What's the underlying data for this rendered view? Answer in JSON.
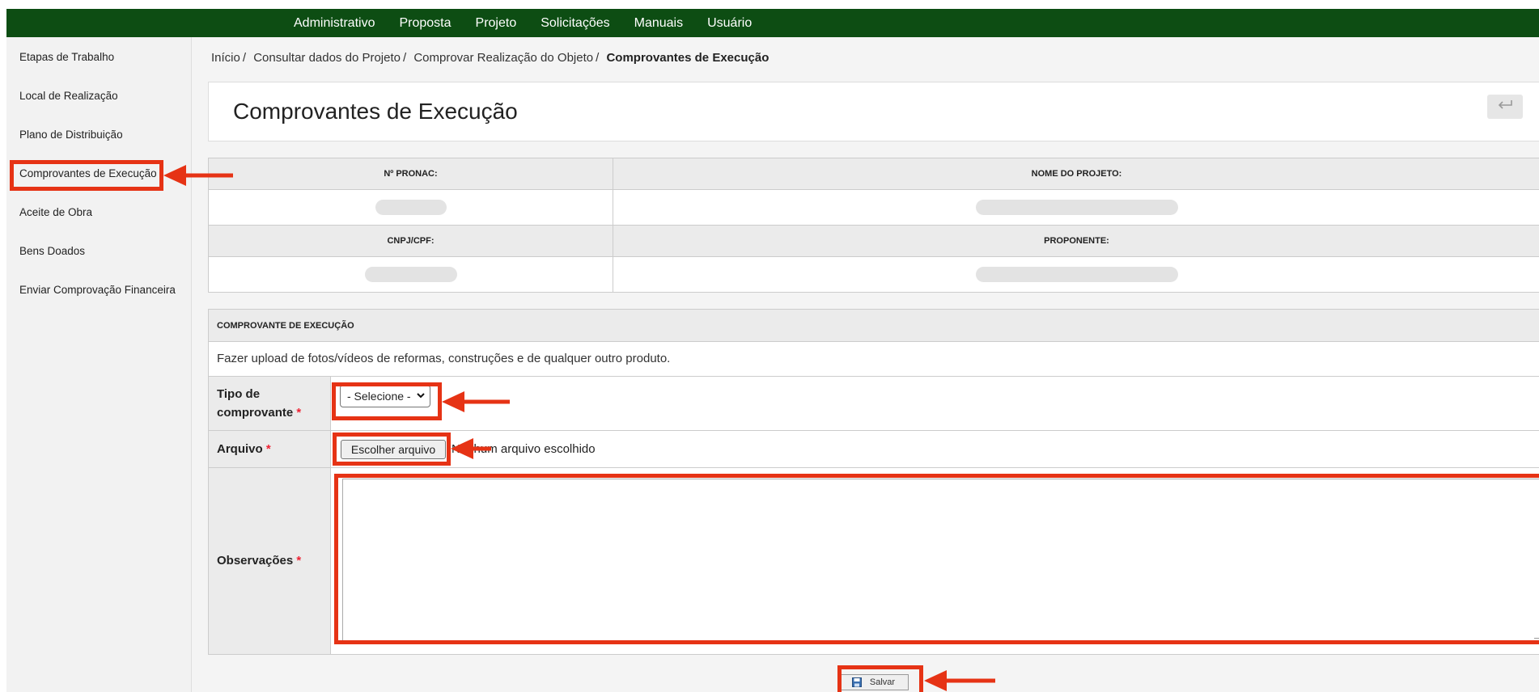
{
  "nav": {
    "items": [
      "Administrativo",
      "Proposta",
      "Projeto",
      "Solicitações",
      "Manuais",
      "Usuário"
    ]
  },
  "sidebar": {
    "items": [
      "Etapas de Trabalho",
      "Local de Realização",
      "Plano de Distribuição",
      "Comprovantes de Execução",
      "Aceite de Obra",
      "Bens Doados",
      "Enviar Comprovação Financeira"
    ],
    "active_index": 3
  },
  "breadcrumb": {
    "items": [
      "Início",
      "Consultar dados do Projeto",
      "Comprovar Realização do Objeto"
    ],
    "current": "Comprovantes de Execução"
  },
  "page": {
    "title": "Comprovantes de Execução"
  },
  "project_info": {
    "pronac_label": "Nº PRONAC:",
    "nome_label": "NOME DO PROJETO:",
    "cnpj_label": "CNPJ/CPF:",
    "proponente_label": "PROPONENTE:"
  },
  "form": {
    "header": "COMPROVANTE DE EXECUÇÃO",
    "description": "Fazer upload de fotos/vídeos de reformas, construções e de qualquer outro produto.",
    "tipo_label_line1": "Tipo de",
    "tipo_label_line2": "comprovante",
    "required_mark": "*",
    "tipo_selected": "- Selecione -",
    "arquivo_label": "Arquivo",
    "file_button": "Escolher arquivo",
    "file_status": "Nenhum arquivo escolhido",
    "observacoes_label": "Observações",
    "save_label": "Salvar"
  },
  "colors": {
    "topbar": "#0d4d13",
    "annotation": "#e63315",
    "required": "#e22233"
  },
  "icons": {
    "back": "return-arrow-icon",
    "save": "floppy-disk-icon",
    "select": "chevron-down-icon"
  }
}
